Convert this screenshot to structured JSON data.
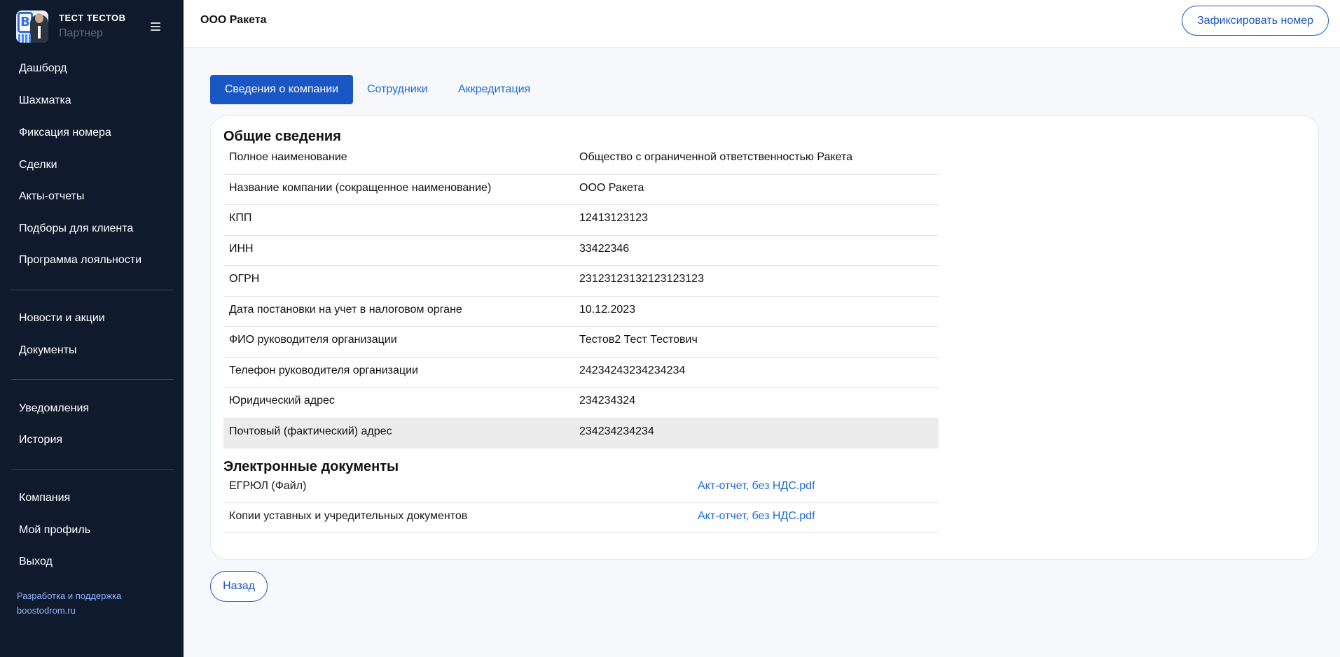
{
  "sidebar": {
    "user": {
      "name": "ТЕСТ ТЕСТОВ",
      "role": "Партнер",
      "avatar_badge": "B"
    },
    "items_main": [
      {
        "label": "Дашборд"
      },
      {
        "label": "Шахматка"
      },
      {
        "label": "Фиксация номера"
      },
      {
        "label": "Сделки"
      },
      {
        "label": "Акты-отчеты"
      },
      {
        "label": "Подборы для клиента"
      },
      {
        "label": "Программа лояльности"
      }
    ],
    "items_info": [
      {
        "label": "Новости и акции"
      },
      {
        "label": "Документы"
      }
    ],
    "items_notify": [
      {
        "label": "Уведомления"
      },
      {
        "label": "История"
      }
    ],
    "items_account": [
      {
        "label": "Компания"
      },
      {
        "label": "Мой профиль"
      },
      {
        "label": "Выход"
      }
    ],
    "support": {
      "line1": "Разработка и поддержка",
      "line2": "boostodrom.ru"
    }
  },
  "header": {
    "title": "ООО Ракета",
    "fix_button": "Зафиксировать номер"
  },
  "tabs": [
    {
      "label": "Сведения о компании",
      "active": true
    },
    {
      "label": "Сотрудники",
      "active": false
    },
    {
      "label": "Аккредитация",
      "active": false
    }
  ],
  "general": {
    "title": "Общие сведения",
    "rows": [
      {
        "label": "Полное наименование",
        "value": "Общество с ограниченной ответственностью Ракета"
      },
      {
        "label": "Название компании (сокращенное наименование)",
        "value": "ООО Ракета"
      },
      {
        "label": "КПП",
        "value": "12413123123"
      },
      {
        "label": "ИНН",
        "value": "33422346"
      },
      {
        "label": "ОГРН",
        "value": "23123123132123123123"
      },
      {
        "label": "Дата постановки на учет в налоговом органе",
        "value": "10.12.2023"
      },
      {
        "label": "ФИО руководителя организации",
        "value": "Тестов2 Тест Тестович"
      },
      {
        "label": "Телефон руководителя организации",
        "value": "24234243234234234"
      },
      {
        "label": "Юридический адрес",
        "value": "234234324"
      },
      {
        "label": "Почтовый (фактический) адрес",
        "value": "234234234234"
      }
    ]
  },
  "documents": {
    "title": "Электронные документы",
    "rows": [
      {
        "label": "ЕГРЮЛ (Файл)",
        "file": "Акт-отчет, без НДС.pdf"
      },
      {
        "label": "Копии уставных и учредительных документов",
        "file": "Акт-отчет, без НДС.pdf"
      }
    ]
  },
  "back_button": "Назад",
  "colors": {
    "sidebar_bg": "#0f1b2d",
    "accent": "#1a56c4",
    "link": "#1a6ad4"
  }
}
